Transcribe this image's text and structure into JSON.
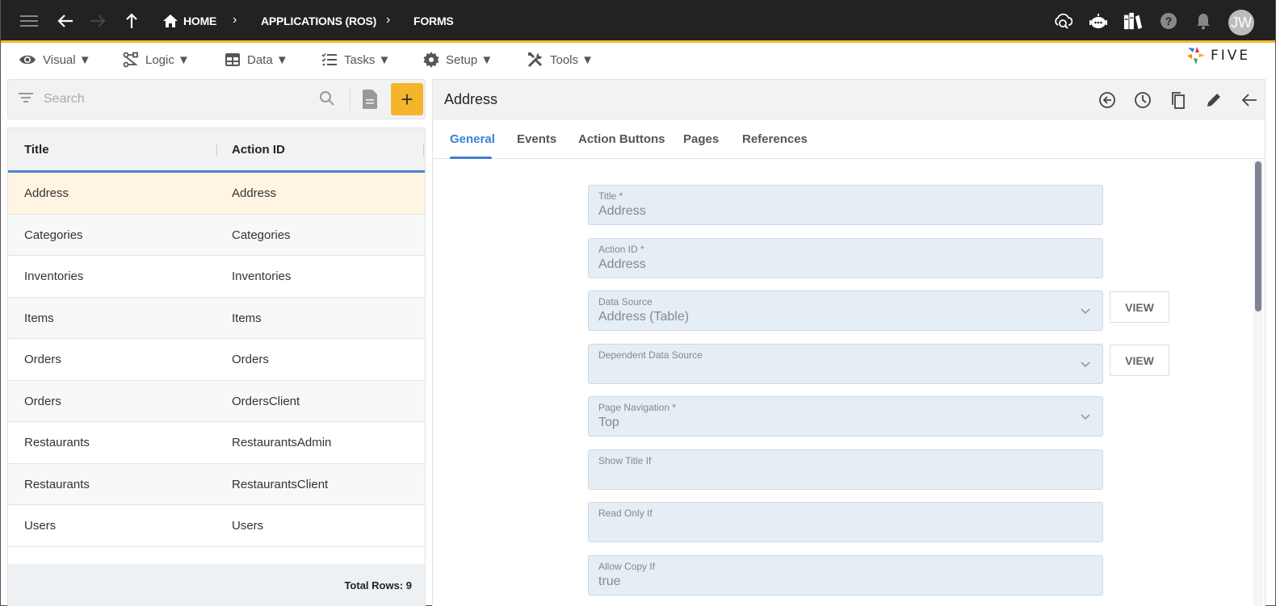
{
  "topbar": {
    "breadcrumbs": [
      "HOME",
      "APPLICATIONS (ROS)",
      "FORMS"
    ],
    "icons": [
      "menu-icon",
      "back-icon",
      "forward-icon",
      "up-icon",
      "home-icon",
      "cloud-search-icon",
      "chatbot-icon",
      "library-icon",
      "help-icon",
      "bell-icon"
    ],
    "avatar_initials": "JW",
    "accent_color": "#f5b52a"
  },
  "menubar": {
    "items": [
      {
        "label": "Visual ▼",
        "icon": "eye-icon"
      },
      {
        "label": "Logic ▼",
        "icon": "logic-icon"
      },
      {
        "label": "Data ▼",
        "icon": "table-icon"
      },
      {
        "label": "Tasks ▼",
        "icon": "checklist-icon"
      },
      {
        "label": "Setup ▼",
        "icon": "gear-icon"
      },
      {
        "label": "Tools ▼",
        "icon": "tools-icon"
      }
    ],
    "logo_text": "FIVE"
  },
  "list": {
    "search_placeholder": "Search",
    "add_label": "+",
    "columns": [
      "Title",
      "Action ID"
    ],
    "rows": [
      {
        "title": "Address",
        "action_id": "Address",
        "selected": true
      },
      {
        "title": "Categories",
        "action_id": "Categories"
      },
      {
        "title": "Inventories",
        "action_id": "Inventories"
      },
      {
        "title": "Items",
        "action_id": "Items"
      },
      {
        "title": "Orders",
        "action_id": "Orders"
      },
      {
        "title": "Orders",
        "action_id": "OrdersClient"
      },
      {
        "title": "Restaurants",
        "action_id": "RestaurantsAdmin"
      },
      {
        "title": "Restaurants",
        "action_id": "RestaurantsClient"
      },
      {
        "title": "Users",
        "action_id": "Users"
      }
    ],
    "total_rows_label": "Total Rows: 9"
  },
  "detail": {
    "title": "Address",
    "header_icons": [
      "revert-icon",
      "history-icon",
      "copy-icon",
      "edit-icon",
      "back-arrow-icon"
    ],
    "tabs": [
      "General",
      "Events",
      "Action Buttons",
      "Pages",
      "References"
    ],
    "active_tab": "General",
    "fields": [
      {
        "label": "Title *",
        "value": "Address",
        "type": "text"
      },
      {
        "label": "Action ID *",
        "value": "Address",
        "type": "text"
      },
      {
        "label": "Data Source",
        "value": "Address (Table)",
        "type": "select",
        "view_button": "VIEW"
      },
      {
        "label": "Dependent Data Source",
        "value": "",
        "type": "select",
        "view_button": "VIEW"
      },
      {
        "label": "Page Navigation *",
        "value": "Top",
        "type": "select"
      },
      {
        "label": "Show Title If",
        "value": "",
        "type": "text"
      },
      {
        "label": "Read Only If",
        "value": "",
        "type": "text"
      },
      {
        "label": "Allow Copy If",
        "value": "true",
        "type": "text"
      }
    ]
  }
}
